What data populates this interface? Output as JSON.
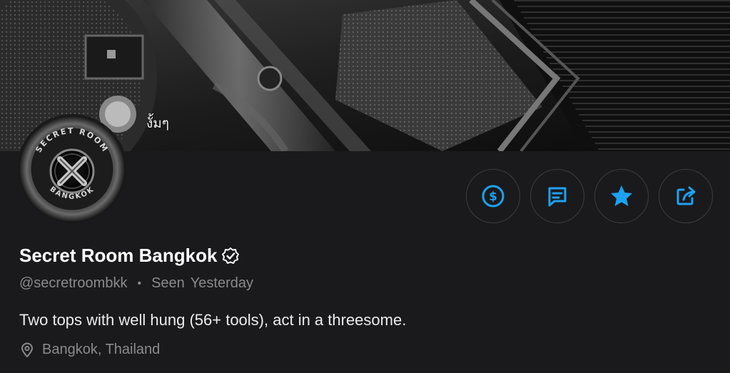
{
  "banner": {
    "caption": "งั้มๆ"
  },
  "avatar": {
    "ring_top_text": "SECRET ROOM",
    "ring_bottom_text": "BANGKOK"
  },
  "actions": [
    {
      "name": "tip",
      "icon": "dollar-coin-icon"
    },
    {
      "name": "message",
      "icon": "message-icon"
    },
    {
      "name": "favorite",
      "icon": "star-icon"
    },
    {
      "name": "share",
      "icon": "share-icon"
    }
  ],
  "profile": {
    "display_name": "Secret Room Bangkok",
    "verified": true,
    "handle": "@secretroombkk",
    "separator": "•",
    "seen_label": "Seen",
    "seen_time": "Yesterday",
    "bio": "Two tops with well hung (56+ tools), act in a threesome.",
    "location": "Bangkok, Thailand"
  },
  "colors": {
    "accent": "#1da1f2",
    "background": "#1a1a1c",
    "muted_text": "#8a8a8f",
    "button_border": "#3d3d42"
  }
}
